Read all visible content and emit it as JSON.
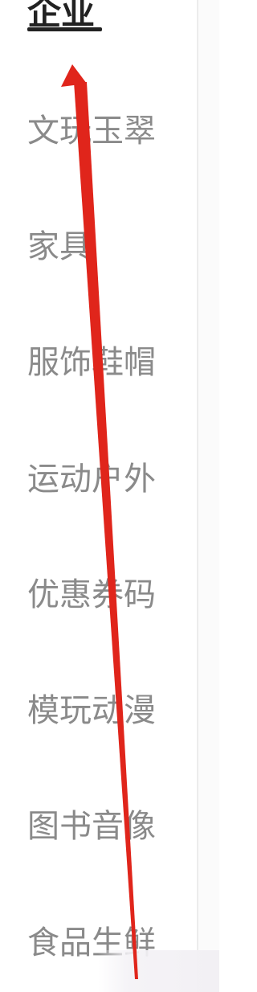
{
  "sidebar": {
    "active_index": 0,
    "items": [
      {
        "label": "企业"
      },
      {
        "label": "文玩玉翠"
      },
      {
        "label": "家具"
      },
      {
        "label": "服饰鞋帽"
      },
      {
        "label": "运动户外"
      },
      {
        "label": "优惠券码"
      },
      {
        "label": "模玩动漫"
      },
      {
        "label": "图书音像"
      },
      {
        "label": "食品生鲜"
      }
    ]
  },
  "colors": {
    "active_text": "#222222",
    "inactive_text": "#8a8a8a",
    "annotation_arrow": "#e0251b"
  }
}
